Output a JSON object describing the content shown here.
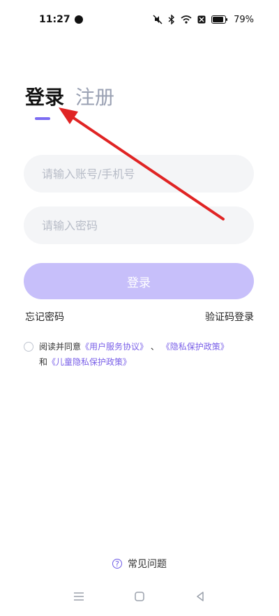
{
  "status_bar": {
    "time": "11:27",
    "battery": "79%"
  },
  "tabs": [
    {
      "label": "登录",
      "active": true
    },
    {
      "label": "注册",
      "active": false
    }
  ],
  "inputs": {
    "account_placeholder": "请输入账号/手机号",
    "password_placeholder": "请输入密码"
  },
  "login_button": "登录",
  "links": {
    "forgot_password": "忘记密码",
    "sms_login": "验证码登录"
  },
  "agreement": {
    "prefix": "阅读并同意",
    "user_agreement": "《用户服务协议》",
    "separator": "、",
    "privacy_policy": "《隐私保护政策》",
    "and": "和",
    "children_policy": "《儿童隐私保护政策》"
  },
  "faq": {
    "icon_glyph": "?",
    "label": "常见问题"
  },
  "colors": {
    "accent": "#7c6cf2",
    "button_bg": "#c7bffa",
    "link": "#7a60e8",
    "annotation_arrow": "#e02424"
  }
}
